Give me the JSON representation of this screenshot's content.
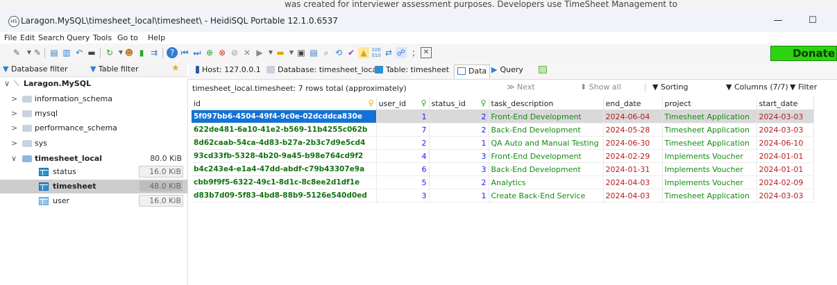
{
  "top_strip_text": "was created for interviewer assessment purposes. Developers use TimeSheet Management to",
  "window": {
    "title": "Laragon.MySQL\\timesheet_local\\timesheet\\ - HeidiSQL Portable 12.1.0.6537",
    "minimize": "—",
    "maximize": "☐"
  },
  "menu": [
    "File",
    "Edit",
    "Search",
    "Query",
    "Tools",
    "Go to",
    "Help"
  ],
  "toolbar": {
    "donate_label": "Donate"
  },
  "left_filters": {
    "db_filter": "Database filter",
    "table_filter": "Table filter"
  },
  "tree": {
    "root": "Laragon.MySQL",
    "databases": [
      {
        "name": "information_schema",
        "size": ""
      },
      {
        "name": "mysql",
        "size": ""
      },
      {
        "name": "performance_schema",
        "size": ""
      },
      {
        "name": "sys",
        "size": ""
      },
      {
        "name": "timesheet_local",
        "size": "80.0 KiB"
      }
    ],
    "tables": [
      {
        "name": "status",
        "size": "16.0 KiB"
      },
      {
        "name": "timesheet",
        "size": "48.0 KiB"
      },
      {
        "name": "user",
        "size": "16.0 KiB"
      }
    ]
  },
  "tabs": {
    "host": "Host: 127.0.0.1",
    "database": "Database: timesheet_local",
    "table": "Table: timesheet",
    "data": "Data",
    "query": "Query"
  },
  "data_bar": {
    "info": "timesheet_local.timesheet: 7 rows total (approximately)",
    "next": "Next",
    "show_all": "Show all",
    "sorting": "Sorting",
    "columns": "Columns (7/7)",
    "filter": "Filter"
  },
  "grid": {
    "columns": [
      "id",
      "user_id",
      "status_id",
      "task_description",
      "end_date",
      "project",
      "start_date"
    ],
    "rows": [
      [
        "5f097bb6-4504-49f4-9c0e-02dcddca830e",
        "1",
        "2",
        "Front-End Development",
        "2024-06-04",
        "Timesheet Application",
        "2024-03-03"
      ],
      [
        "622de481-6a10-41e2-b569-11b4255c062b",
        "7",
        "2",
        "Back-End Development",
        "2024-05-28",
        "Timesheet Application",
        "2024-03-03"
      ],
      [
        "8d62caab-54ca-4d83-b27a-2b3c7d9e5cd4",
        "2",
        "1",
        "QA Auto and Manual Testing",
        "2024-06-30",
        "Timesheet Application",
        "2024-06-10"
      ],
      [
        "93cd33fb-5328-4b20-9a45-b98e764cd9f2",
        "4",
        "3",
        "Front-End Development",
        "2024-02-29",
        "Implements Voucher",
        "2024-01-01"
      ],
      [
        "b4c243e4-e1a4-47dd-abdf-c79b43307e9a",
        "6",
        "3",
        "Back-End Development",
        "2024-01-31",
        "Implements Voucher",
        "2024-01-01"
      ],
      [
        "cbb9f9f5-6322-49c1-8d1c-8c8ee2d1df1e",
        "5",
        "2",
        "Analytics",
        "2024-04-03",
        "Implements Voucher",
        "2024-02-09"
      ],
      [
        "d83b7d09-5f83-4bd8-88b9-5126e540d0ed",
        "3",
        "1",
        "Create Back-End Service",
        "2024-04-03",
        "Timesheet Application",
        "2024-03-03"
      ]
    ]
  }
}
